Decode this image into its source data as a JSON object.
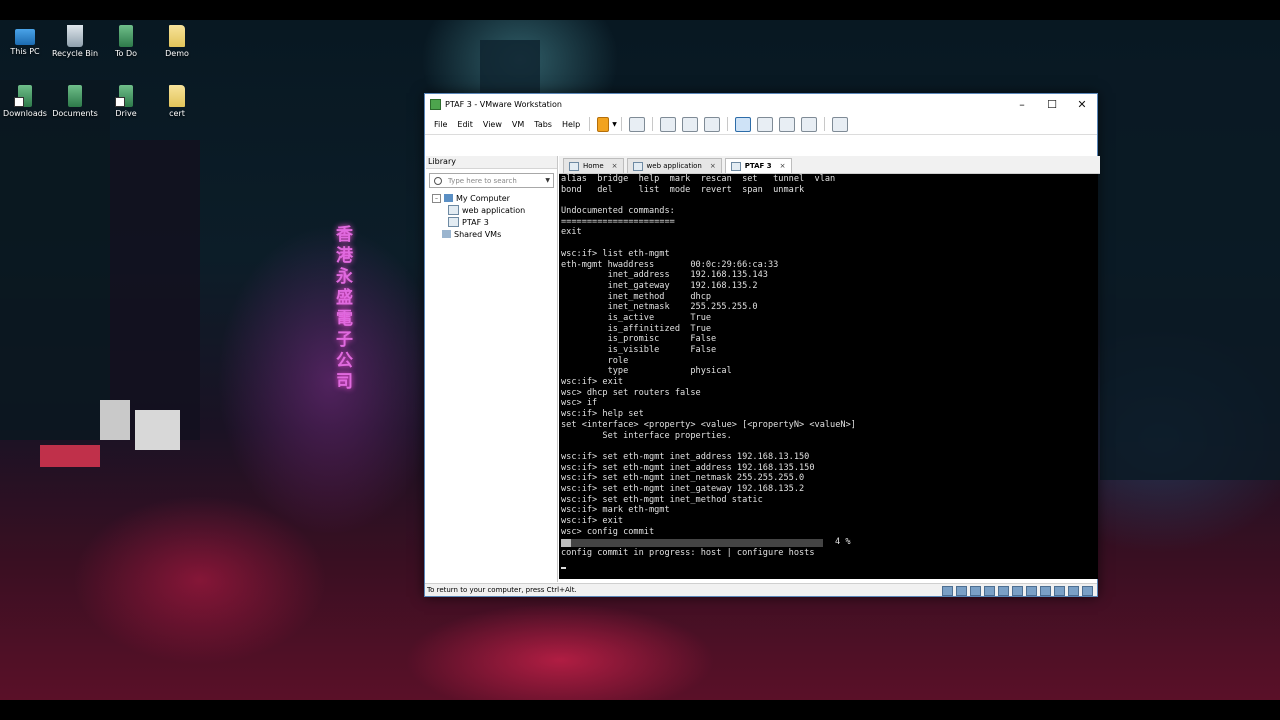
{
  "desktop": {
    "icons": [
      {
        "label": "This PC",
        "icon": "this-pc-icon"
      },
      {
        "label": "Recycle Bin",
        "icon": "recycle-bin-icon"
      },
      {
        "label": "To Do",
        "icon": "app-icon"
      },
      {
        "label": "Demo",
        "icon": "folder-icon"
      },
      {
        "label": "Downloads",
        "icon": "downloads-icon"
      },
      {
        "label": "Documents",
        "icon": "app-icon"
      },
      {
        "label": "Drive",
        "icon": "app-icon"
      },
      {
        "label": "cert",
        "icon": "folder-icon"
      }
    ]
  },
  "window": {
    "title": "PTAF 3 - VMware Workstation",
    "menu": [
      "File",
      "Edit",
      "View",
      "VM",
      "Tabs",
      "Help"
    ]
  },
  "library": {
    "header": "Library",
    "search_placeholder": "Type here to search",
    "tree": {
      "root": "My Computer",
      "children": [
        "web application",
        "PTAF 3"
      ],
      "shared": "Shared VMs"
    }
  },
  "tabs": [
    {
      "label": "Home",
      "active": false
    },
    {
      "label": "web application",
      "active": false
    },
    {
      "label": "PTAF 3",
      "active": true
    }
  ],
  "console": {
    "lines": [
      "alias  bridge  help  mark  rescan  set   tunnel  vlan",
      "bond   del     list  mode  revert  span  unmark",
      "",
      "Undocumented commands:",
      "======================",
      "exit",
      "",
      "wsc:if> list eth-mgmt",
      "eth-mgmt hwaddress       00:0c:29:66:ca:33",
      "         inet_address    192.168.135.143",
      "         inet_gateway    192.168.135.2",
      "         inet_method     dhcp",
      "         inet_netmask    255.255.255.0",
      "         is_active       True",
      "         is_affinitized  True",
      "         is_promisc      False",
      "         is_visible      False",
      "         role",
      "         type            physical",
      "wsc:if> exit",
      "wsc> dhcp set routers false",
      "wsc> if",
      "wsc:if> help set",
      "set <interface> <property> <value> [<propertyN> <valueN>]",
      "        Set interface properties.",
      "",
      "wsc:if> set eth-mgmt inet_address 192.168.13.150",
      "wsc:if> set eth-mgmt inet_address 192.168.135.150",
      "wsc:if> set eth-mgmt inet_netmask 255.255.255.0",
      "wsc:if> set eth-mgmt inet_gateway 192.168.135.2",
      "wsc:if> set eth-mgmt inet_method static",
      "wsc:if> mark eth-mgmt",
      "wsc:if> exit",
      "wsc> config commit"
    ],
    "progress_percent_label": "4 %",
    "progress_fraction": 0.04,
    "progress_text": "config commit in progress: host | configure hosts"
  },
  "statusbar": {
    "text": "To return to your computer, press Ctrl+Alt."
  }
}
